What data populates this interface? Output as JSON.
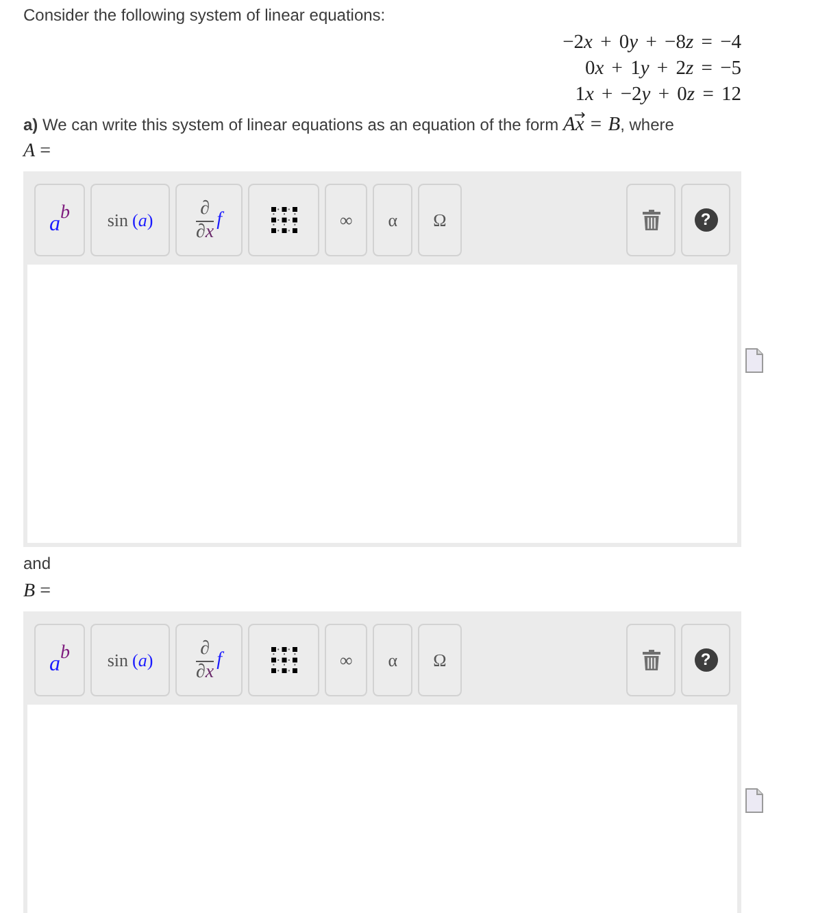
{
  "intro": "Consider the following system of linear equations:",
  "equations": [
    {
      "terms": [
        {
          "coefficient": "−2",
          "variable": "x"
        },
        {
          "operator": "+",
          "coefficient": "0",
          "variable": "y"
        },
        {
          "operator": "+",
          "coefficient": "−8",
          "variable": "z"
        }
      ],
      "relation": "=",
      "rhs": "−4"
    },
    {
      "terms": [
        {
          "coefficient": "0",
          "variable": "x"
        },
        {
          "operator": "+",
          "coefficient": "1",
          "variable": "y"
        },
        {
          "operator": "+",
          "coefficient": "2",
          "variable": "z"
        }
      ],
      "relation": "=",
      "rhs": "−5"
    },
    {
      "terms": [
        {
          "coefficient": "1",
          "variable": "x"
        },
        {
          "operator": "+",
          "coefficient": "−2",
          "variable": "y"
        },
        {
          "operator": "+",
          "coefficient": "0",
          "variable": "z"
        }
      ],
      "relation": "=",
      "rhs": "12"
    }
  ],
  "question": {
    "marker": "a)",
    "text": "We can write this system of linear equations as an equation of the form",
    "math": {
      "matrix": "A",
      "vector": "x",
      "accent": "→",
      "relation": "=",
      "rhs": "B"
    },
    "tail": ", where"
  },
  "editors": [
    {
      "label": "*A* =",
      "toolbar": [
        {
          "kind": "power",
          "base": "a",
          "exponent": "b"
        },
        {
          "kind": "function",
          "name": "sin",
          "argument": "(*a*)"
        },
        {
          "kind": "derivative",
          "operator": "∂",
          "variable": "∂*x*",
          "operand": "f"
        },
        {
          "kind": "matrix"
        },
        {
          "kind": "symbol",
          "text": "∞"
        },
        {
          "kind": "symbol",
          "text": "α"
        },
        {
          "kind": "symbol",
          "text": "Ω"
        },
        {
          "kind": "delete"
        },
        {
          "kind": "help",
          "text": "?"
        }
      ]
    },
    {
      "lead": "and",
      "label": "*B* =",
      "toolbar": [
        {
          "kind": "power",
          "base": "a",
          "exponent": "b"
        },
        {
          "kind": "function",
          "name": "sin",
          "argument": "(*a*)"
        },
        {
          "kind": "derivative",
          "operator": "∂",
          "variable": "∂*x*",
          "operand": "f"
        },
        {
          "kind": "matrix"
        },
        {
          "kind": "symbol",
          "text": "∞"
        },
        {
          "kind": "symbol",
          "text": "α"
        },
        {
          "kind": "symbol",
          "text": "Ω"
        },
        {
          "kind": "delete"
        },
        {
          "kind": "help",
          "text": "?"
        }
      ]
    }
  ]
}
